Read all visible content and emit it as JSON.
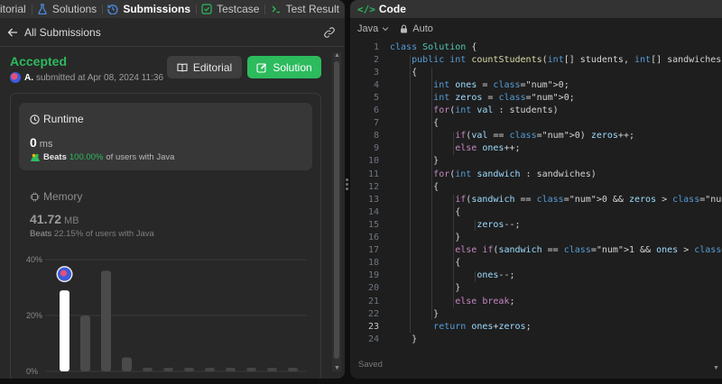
{
  "tabs": [
    {
      "label": "itorial",
      "icon": "book-icon",
      "active": false
    },
    {
      "label": "Solutions",
      "icon": "flask-icon",
      "active": false
    },
    {
      "label": "Submissions",
      "icon": "history-icon",
      "active": true
    },
    {
      "label": "Testcase",
      "icon": "checkbox-icon",
      "active": false
    },
    {
      "label": "Test Result",
      "icon": "terminal-icon",
      "active": false
    }
  ],
  "subheader": {
    "back_label": "All Submissions"
  },
  "result": {
    "status": "Accepted",
    "status_color": "#2cbb5d",
    "user": "A.",
    "submitted_text": "submitted at Apr 08, 2024 11:36"
  },
  "buttons": {
    "editorial": "Editorial",
    "solution": "Solution"
  },
  "runtime": {
    "title": "Runtime",
    "value": "0",
    "unit": "ms",
    "beats_label": "Beats",
    "percent": "100.00%",
    "suffix": "of users with Java"
  },
  "memory": {
    "title": "Memory",
    "value": "41.72",
    "unit": "MB",
    "beats_label": "Beats",
    "percent": "22.15%",
    "suffix": "of users with Java"
  },
  "chart_data": {
    "type": "bar",
    "ylabels": [
      "40%",
      "20%",
      "0%"
    ],
    "ylim": [
      0,
      40
    ],
    "values": [
      29,
      20,
      36,
      5,
      1.3,
      1.3,
      1.3,
      1.3,
      1.3,
      1.3,
      1.3,
      1.3
    ],
    "highlight_index": 0,
    "grid": true
  },
  "editor": {
    "title": "Code",
    "language": "Java",
    "mode": "Auto",
    "status": "Saved",
    "current_line": 23,
    "lines": [
      "class Solution {",
      "    public int countStudents(int[] students, int[] sandwiches)",
      "    {",
      "        int ones = 0;",
      "        int zeros = 0;",
      "        for(int val : students)",
      "        {",
      "            if(val == 0) zeros++;",
      "            else ones++;",
      "        }",
      "        for(int sandwich : sandwiches)",
      "        {",
      "            if(sandwich == 0 && zeros > 0)",
      "            {",
      "                zeros--;",
      "            }",
      "            else if(sandwich == 1 && ones > 0)",
      "            {",
      "                ones--;",
      "            }",
      "            else break;",
      "        }",
      "        return ones+zeros;",
      "    }"
    ]
  }
}
